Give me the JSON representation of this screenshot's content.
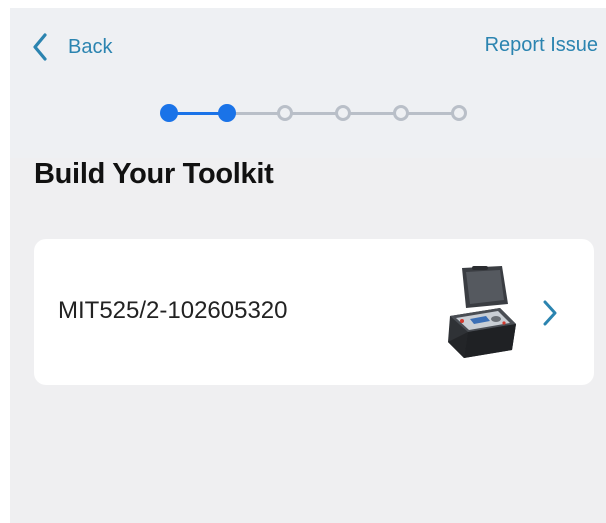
{
  "nav": {
    "back_label": "Back",
    "report_label": "Report Issue"
  },
  "stepper": {
    "total_steps": 6,
    "current_step": 2,
    "active_color": "#1a73e8",
    "inactive_color": "#b9bfc8"
  },
  "page": {
    "title": "Build Your Toolkit"
  },
  "toolkit_items": [
    {
      "label": "MIT525/2-102605320",
      "icon": "insulation-tester-image"
    }
  ],
  "colors": {
    "link": "#2b84b0",
    "background": "#efeff1",
    "card": "#ffffff"
  }
}
